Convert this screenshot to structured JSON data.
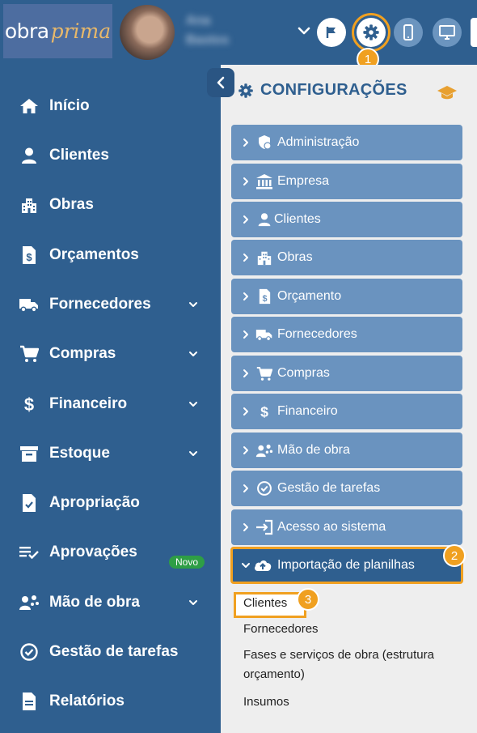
{
  "header": {
    "logo_part1": "obra",
    "logo_part2": "prima",
    "user_name": "Ana",
    "user_surname": "Bastos",
    "buttons": [
      "flag-icon",
      "gear-icon",
      "mobile-icon",
      "monitor-icon"
    ]
  },
  "callouts": {
    "one": "1",
    "two": "2",
    "three": "3"
  },
  "sidebar": {
    "items": [
      {
        "label": "Início",
        "icon": "home-icon"
      },
      {
        "label": "Clientes",
        "icon": "user-icon"
      },
      {
        "label": "Obras",
        "icon": "building-icon"
      },
      {
        "label": "Orçamentos",
        "icon": "invoice-icon"
      },
      {
        "label": "Fornecedores",
        "icon": "truck-icon",
        "expandable": true
      },
      {
        "label": "Compras",
        "icon": "cart-icon",
        "expandable": true
      },
      {
        "label": "Financeiro",
        "icon": "dollar-icon",
        "expandable": true
      },
      {
        "label": "Estoque",
        "icon": "archive-icon",
        "expandable": true
      },
      {
        "label": "Apropriação",
        "icon": "file-check-icon"
      },
      {
        "label": "Aprovações",
        "icon": "list-check-icon"
      },
      {
        "label": "Mão de obra",
        "icon": "workers-icon",
        "expandable": true
      },
      {
        "label": "Gestão de tarefas",
        "icon": "check-circle-icon"
      },
      {
        "label": "Relatórios",
        "icon": "report-icon"
      }
    ],
    "new_badge": "Novo"
  },
  "config": {
    "title": "CONFIGURAÇÕES",
    "sections": [
      {
        "label": "Administração",
        "icon": "shield-icon"
      },
      {
        "label": "Empresa",
        "icon": "bank-icon"
      },
      {
        "label": "Clientes",
        "icon": "user-icon"
      },
      {
        "label": "Obras",
        "icon": "building-icon"
      },
      {
        "label": "Orçamento",
        "icon": "invoice-icon"
      },
      {
        "label": "Fornecedores",
        "icon": "truck-icon"
      },
      {
        "label": "Compras",
        "icon": "cart-icon"
      },
      {
        "label": "Financeiro",
        "icon": "dollar-icon"
      },
      {
        "label": "Mão de obra",
        "icon": "workers-icon"
      },
      {
        "label": "Gestão de tarefas",
        "icon": "check-circle-icon"
      },
      {
        "label": "Acesso ao sistema",
        "icon": "login-icon"
      },
      {
        "label": "Importação de planilhas",
        "icon": "cloud-upload-icon",
        "expanded": true
      }
    ],
    "submenu": [
      "Clientes",
      "Fornecedores",
      "Fases e serviços de obra (estrutura orçamento)",
      "Insumos"
    ]
  },
  "colors": {
    "primary": "#2f5f8f",
    "section": "#6a93bf",
    "highlight": "#f0a020",
    "badge_green": "#2e9e45",
    "accent_gold": "#e8a030"
  }
}
